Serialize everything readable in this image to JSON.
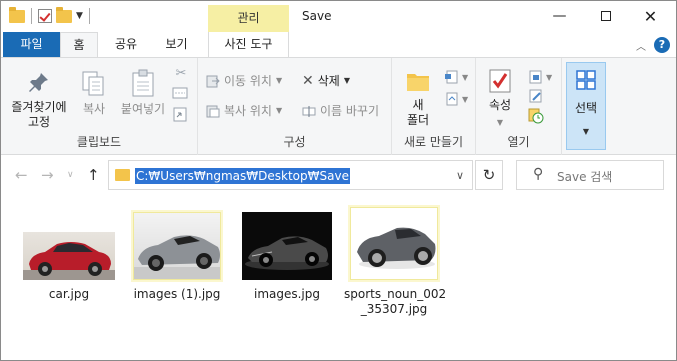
{
  "window": {
    "title": "Save",
    "context_tab": "관리",
    "min_icon": "minimize-icon",
    "max_icon": "maximize-icon",
    "close_icon": "close-icon"
  },
  "tabs": {
    "file": "파일",
    "home": "홈",
    "share": "공유",
    "view": "보기",
    "photo_tools": "사진 도구"
  },
  "ribbon": {
    "clipboard": {
      "label": "클립보드",
      "pin": "즐겨찾기에\n고정",
      "copy": "복사",
      "paste": "붙여넣기"
    },
    "organize": {
      "label": "구성",
      "move_to": "이동 위치",
      "copy_to": "복사 위치",
      "delete": "삭제",
      "rename": "이름 바꾸기"
    },
    "new": {
      "label": "새로 만들기",
      "new_folder": "새\n폴더"
    },
    "open": {
      "label": "열기",
      "properties": "속성"
    },
    "select": {
      "select": "선택"
    }
  },
  "nav": {
    "address": "C:₩Users₩ngmas₩Desktop₩Save",
    "search_placeholder": "Save 검색"
  },
  "files": [
    {
      "name": "car.jpg",
      "icon": "red-sedan-thumbnail"
    },
    {
      "name": "images (1).jpg",
      "icon": "silver-supercar-thumbnail"
    },
    {
      "name": "images.jpg",
      "icon": "dark-supercar-thumbnail"
    },
    {
      "name": "sports_noun_002\n_35307.jpg",
      "icon": "grey-concept-car-thumbnail"
    }
  ],
  "colors": {
    "file_tab": "#1a6bb5",
    "context_tab": "#f6efa4",
    "selection": "#2e74d4"
  }
}
